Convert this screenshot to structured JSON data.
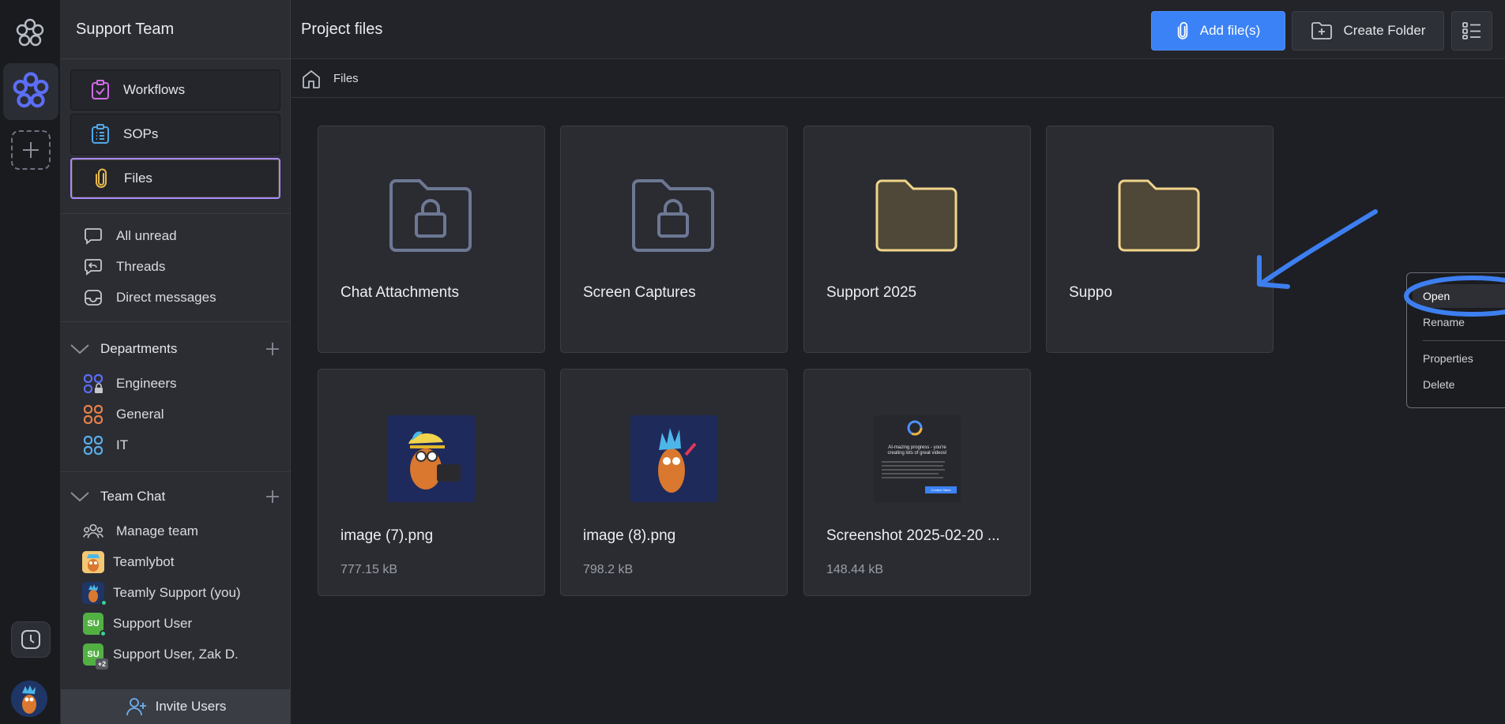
{
  "sidebar": {
    "team_title": "Support Team",
    "nav": [
      {
        "label": "Workflows"
      },
      {
        "label": "SOPs"
      },
      {
        "label": "Files"
      }
    ],
    "quick": [
      {
        "label": "All unread"
      },
      {
        "label": "Threads"
      },
      {
        "label": "Direct messages"
      }
    ],
    "departments": {
      "label": "Departments",
      "items": [
        {
          "label": "Engineers"
        },
        {
          "label": "General"
        },
        {
          "label": "IT"
        }
      ]
    },
    "team_chat": {
      "label": "Team Chat",
      "items": [
        {
          "label": "Manage team"
        },
        {
          "label": "Teamlybot"
        },
        {
          "label": "Teamly Support (you)"
        },
        {
          "label": "Support User",
          "initials": "SU"
        },
        {
          "label": "Support User, Zak D.",
          "initials": "SU",
          "extra": "+2"
        }
      ]
    },
    "invite_label": "Invite Users"
  },
  "header": {
    "title": "Project files",
    "add_files_label": "Add file(s)",
    "create_folder_label": "Create Folder"
  },
  "breadcrumb": {
    "current": "Files"
  },
  "files": [
    {
      "name": "Chat Attachments",
      "kind": "locked-folder"
    },
    {
      "name": "Screen Captures",
      "kind": "locked-folder"
    },
    {
      "name": "Support 2025",
      "kind": "folder"
    },
    {
      "name": "Suppo",
      "kind": "folder"
    },
    {
      "name": "image (7).png",
      "size": "777.15 kB",
      "kind": "image"
    },
    {
      "name": "image (8).png",
      "size": "798.2 kB",
      "kind": "image"
    },
    {
      "name": "Screenshot 2025-02-20 ...",
      "size": "148.44 kB",
      "kind": "screenshot"
    }
  ],
  "screenshot_thumb": {
    "headline": "AI-mazing progress - you're creating lots of great videos!",
    "button": "Contact Sales"
  },
  "context_menu": {
    "items": [
      "Open",
      "Rename",
      "Properties",
      "Delete"
    ]
  },
  "colors": {
    "accent_blue": "#3b82f6",
    "active_border": "#a78bfa",
    "folder_fill": "#4f4838",
    "folder_stroke": "#f0d48a",
    "locked_folder_stroke": "#6d7894"
  }
}
